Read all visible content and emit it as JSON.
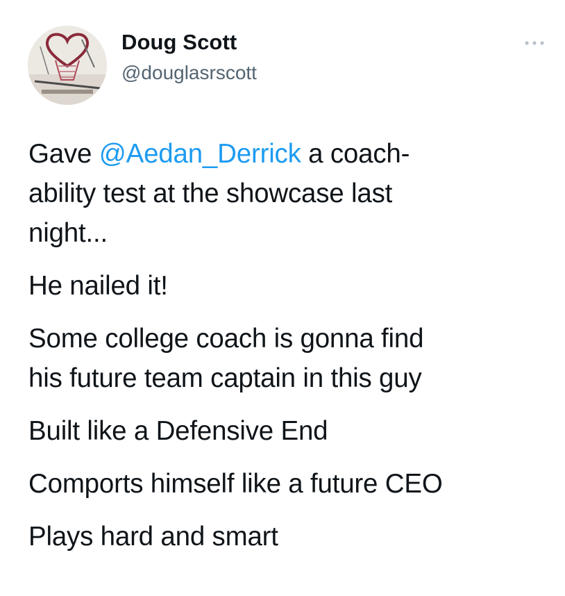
{
  "author": {
    "name": "Doug Scott",
    "handle": "@douglasrscott"
  },
  "tweet": {
    "p1": {
      "before": "Gave ",
      "mention": "@Aedan_Derrick",
      "line1_end": " a coach-",
      "line2": "ability test at the showcase last",
      "line3": "night..."
    },
    "p2": "He nailed it!",
    "p3": {
      "line1": "Some college coach is gonna find",
      "line2": "his future team captain in this guy"
    },
    "p4": "Built like a Defensive End",
    "p5": "Comports himself like a future CEO",
    "p6": "Plays hard and smart"
  },
  "icons": {
    "more": "more-horizontal-icon",
    "avatar": "basketball-hoop-heart-photo"
  },
  "colors": {
    "mention": "#1d9bf0",
    "handle": "#536471",
    "text": "#0f1419",
    "more_dots": "#b9c2ca"
  }
}
